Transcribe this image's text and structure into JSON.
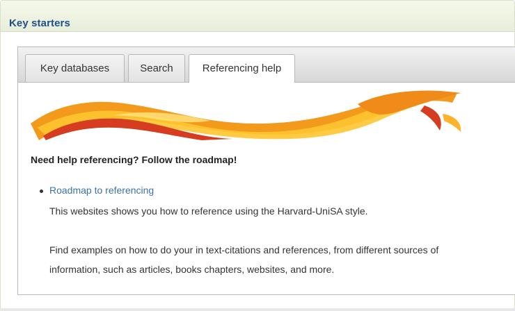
{
  "panel": {
    "title": "Key starters"
  },
  "tabs": [
    {
      "label": "Key databases",
      "active": false
    },
    {
      "label": "Search",
      "active": false
    },
    {
      "label": "Referencing help",
      "active": true
    }
  ],
  "content": {
    "heading": "Need help referencing? Follow the roadmap!",
    "link_label": "Roadmap to referencing",
    "description_1": "This websites shows you how to reference using the Harvard-UniSA style.",
    "description_2_line_1": "Find examples on how to do your in text-citations and references, from different sources of",
    "description_2_line_2": "information, such as articles, books chapters, websites, and more."
  },
  "colors": {
    "title": "#1f4f8a",
    "link": "#3b73a8",
    "banner_orange": "#f39a1d",
    "banner_red": "#d63c1f",
    "banner_yellow": "#ffc531"
  }
}
